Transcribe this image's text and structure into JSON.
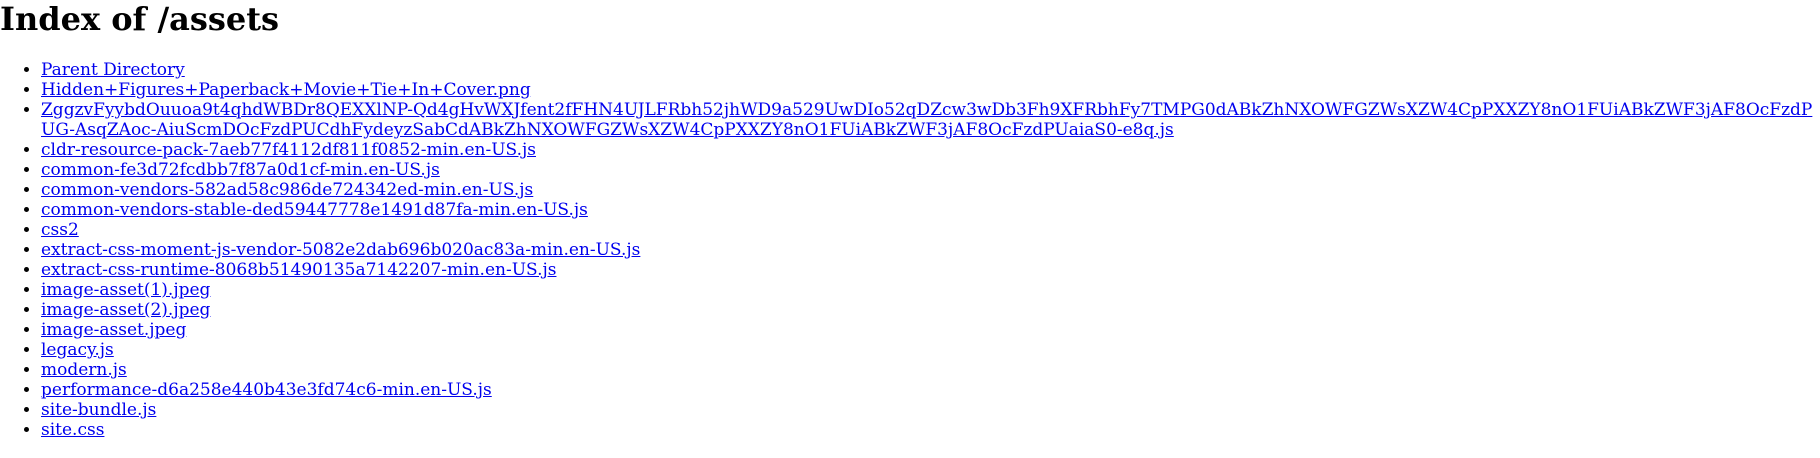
{
  "page": {
    "title": "Index of /assets"
  },
  "listing": {
    "items": [
      {
        "label": "Parent Directory"
      },
      {
        "label": "Hidden+Figures+Paperback+Movie+Tie+In+Cover.png"
      },
      {
        "label": "ZggzvFyybdOuuoa9t4qhdWBDr8QEXXlNP-Qd4gHvWXJfent2fFHN4UJLFRbh52jhWD9a529UwDIo52qDZcw3wDb3Fh9XFRbhFy7TMPG0dABkZhNXOWFGZWsXZW4CpPXXZY8nO1FUiABkZWF3jAF8OcFzdPUG-AsqZAoc-AiuScmDOcFzdPUCdhFydeyzSabCdABkZhNXOWFGZWsXZW4CpPXXZY8nO1FUiABkZWF3jAF8OcFzdPUaiaS0-e8q.js"
      },
      {
        "label": "cldr-resource-pack-7aeb77f4112df811f0852-min.en-US.js"
      },
      {
        "label": "common-fe3d72fcdbb7f87a0d1cf-min.en-US.js"
      },
      {
        "label": "common-vendors-582ad58c986de724342ed-min.en-US.js"
      },
      {
        "label": "common-vendors-stable-ded59447778e1491d87fa-min.en-US.js"
      },
      {
        "label": "css2"
      },
      {
        "label": "extract-css-moment-js-vendor-5082e2dab696b020ac83a-min.en-US.js"
      },
      {
        "label": "extract-css-runtime-8068b51490135a7142207-min.en-US.js"
      },
      {
        "label": "image-asset(1).jpeg"
      },
      {
        "label": "image-asset(2).jpeg"
      },
      {
        "label": "image-asset.jpeg"
      },
      {
        "label": "legacy.js"
      },
      {
        "label": "modern.js"
      },
      {
        "label": "performance-d6a258e440b43e3fd74c6-min.en-US.js"
      },
      {
        "label": "site-bundle.js"
      },
      {
        "label": "site.css"
      }
    ]
  },
  "colors": {
    "link": "#0000ee",
    "text": "#000000",
    "background": "#ffffff"
  }
}
